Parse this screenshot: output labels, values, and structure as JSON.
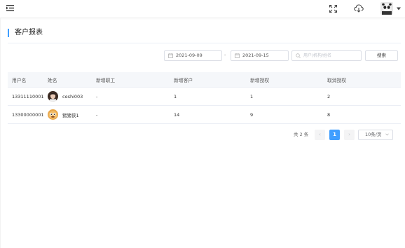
{
  "header": {
    "menu_icon": "menu-fold-icon",
    "fullscreen_icon": "fullscreen-icon",
    "cloud_icon": "cloud-download-icon",
    "avatar_icon": "user-avatar",
    "caret_icon": "caret-down-icon"
  },
  "page": {
    "title": "客户报表",
    "accent": "#409eff"
  },
  "filters": {
    "start_date": "2021-09-09",
    "separator": "-",
    "end_date": "2021-09-15",
    "search_placeholder": "用户/机构/姓名",
    "search_value": "",
    "search_button": "搜索"
  },
  "table": {
    "columns": [
      "用户名",
      "姓名",
      "新增职工",
      "新增客户",
      "新增授权",
      "取消授权"
    ],
    "rows": [
      {
        "username": "13311110001",
        "name": "ceshi003",
        "new_staff": "-",
        "new_customers": "1",
        "new_auth": "1",
        "cancel_auth": "2"
      },
      {
        "username": "13300000001",
        "name": "猪猪侠1",
        "new_staff": "-",
        "new_customers": "14",
        "new_auth": "9",
        "cancel_auth": "8"
      }
    ]
  },
  "pagination": {
    "total_text": "共 2 条",
    "prev": "‹",
    "current_page": "1",
    "next": "›",
    "page_size": "10条/页"
  }
}
